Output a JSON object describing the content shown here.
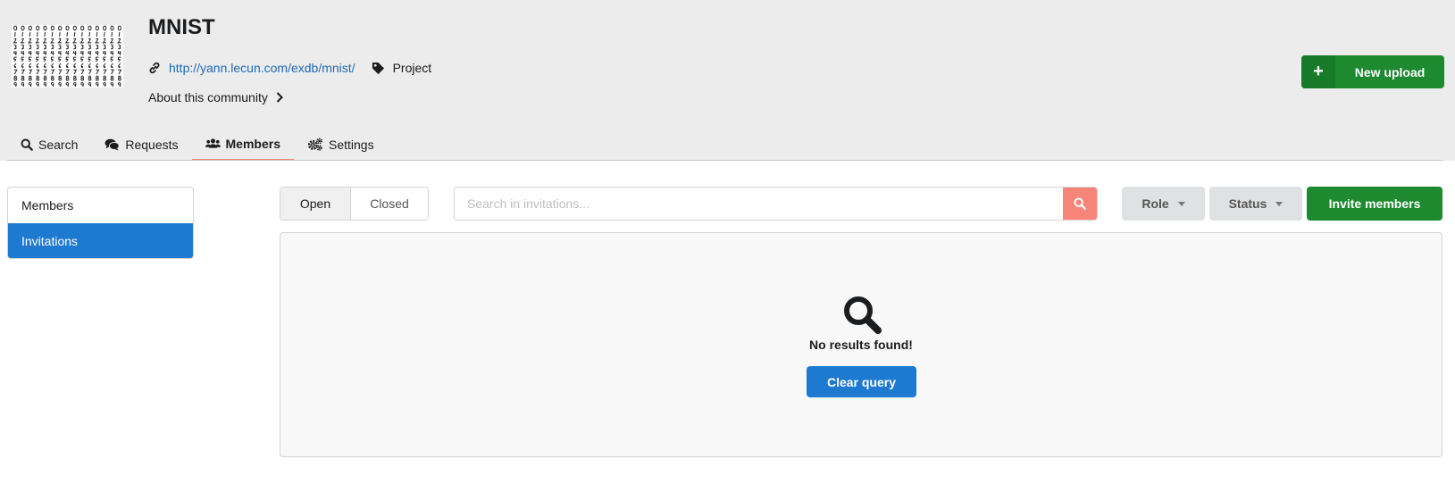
{
  "community": {
    "title": "MNIST",
    "url": "http://yann.lecun.com/exdb/mnist/",
    "type": "Project",
    "about_label": "About this community"
  },
  "header": {
    "new_upload_label": "New upload"
  },
  "tabs": [
    {
      "label": "Search",
      "icon": "search-icon",
      "active": false
    },
    {
      "label": "Requests",
      "icon": "comments-icon",
      "active": false
    },
    {
      "label": "Members",
      "icon": "users-icon",
      "active": true
    },
    {
      "label": "Settings",
      "icon": "cogs-icon",
      "active": false
    }
  ],
  "sidebar": {
    "items": [
      {
        "label": "Members",
        "active": false
      },
      {
        "label": "Invitations",
        "active": true
      }
    ]
  },
  "toolbar": {
    "open_label": "Open",
    "closed_label": "Closed",
    "search_placeholder": "Search in invitations...",
    "role_label": "Role",
    "status_label": "Status",
    "invite_label": "Invite members"
  },
  "results": {
    "empty_message": "No results found!",
    "clear_label": "Clear query"
  },
  "colors": {
    "primary": "#1e7ad1",
    "positive": "#1d8a2f",
    "search_button": "#f7857a",
    "active_tab_underline": "#f08672"
  }
}
